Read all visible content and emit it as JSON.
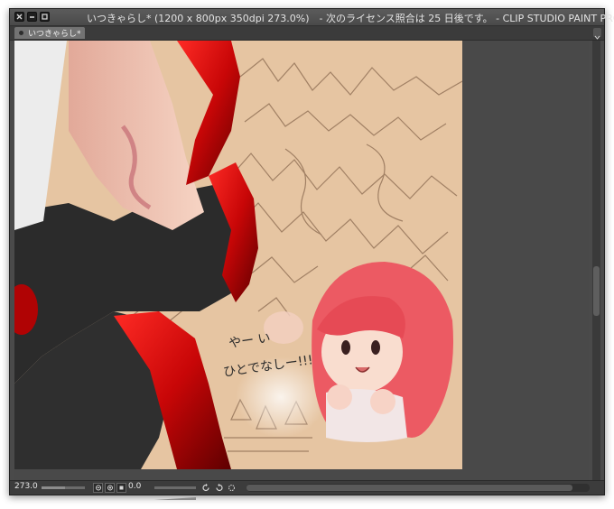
{
  "window": {
    "title": "いつきゃらし* (1200 x 800px 350dpi 273.0%)　- 次のライセンス照合は 25 日後です。 - CLIP STUDIO PAINT PRO"
  },
  "tabs": [
    {
      "label": "いつきゃらし*"
    }
  ],
  "canvas": {
    "speech_line1": "やー い",
    "speech_line2": "ひとでなしー!!!"
  },
  "statusbar": {
    "zoom": "273.0",
    "zoom_level": 0.55,
    "rotation": "0.0",
    "rotation_level": 0.5,
    "hscroll_level": 0.95
  },
  "colors": {
    "frame": "#4a4a4a",
    "parchment": "#e6c5a2",
    "crimson": "#c5060a",
    "hair": "#e8535a"
  }
}
